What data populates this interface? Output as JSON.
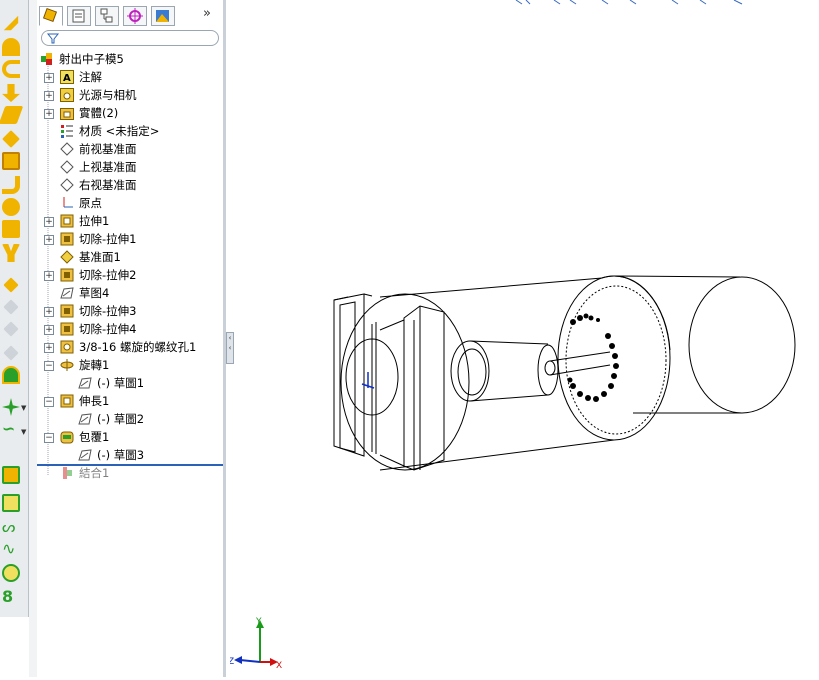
{
  "tree": {
    "root": "射出中子模5",
    "items": [
      {
        "label": "注解",
        "icon": "annotations-icon",
        "expand": "+"
      },
      {
        "label": "光源与相机",
        "icon": "lights-cameras-icon",
        "expand": "+"
      },
      {
        "label": "實體(2)",
        "icon": "solid-bodies-folder-icon",
        "expand": "+"
      },
      {
        "label": "材质 <未指定>",
        "icon": "material-icon",
        "expand": ""
      },
      {
        "label": "前视基准面",
        "icon": "plane-icon",
        "expand": ""
      },
      {
        "label": "上视基准面",
        "icon": "plane-icon",
        "expand": ""
      },
      {
        "label": "右视基准面",
        "icon": "plane-icon",
        "expand": ""
      },
      {
        "label": "原点",
        "icon": "origin-icon",
        "expand": ""
      },
      {
        "label": "拉伸1",
        "icon": "extrude-icon",
        "expand": "+"
      },
      {
        "label": "切除-拉伸1",
        "icon": "cut-extrude-icon",
        "expand": "+"
      },
      {
        "label": "基准面1",
        "icon": "reference-plane-icon",
        "expand": ""
      },
      {
        "label": "切除-拉伸2",
        "icon": "cut-extrude-icon",
        "expand": "+"
      },
      {
        "label": "草图4",
        "icon": "sketch-icon",
        "expand": ""
      },
      {
        "label": "切除-拉伸3",
        "icon": "cut-extrude-icon",
        "expand": "+"
      },
      {
        "label": "切除-拉伸4",
        "icon": "cut-extrude-icon",
        "expand": "+"
      },
      {
        "label": "3/8-16 螺旋的螺纹孔1",
        "icon": "hole-wizard-icon",
        "expand": "+"
      },
      {
        "label": "旋轉1",
        "icon": "revolve-icon",
        "expand": "−"
      },
      {
        "label": "(-) 草圖1",
        "icon": "sketch-icon",
        "expand": ""
      },
      {
        "label": "伸長1",
        "icon": "extrude-icon",
        "expand": "−"
      },
      {
        "label": "(-) 草圖2",
        "icon": "sketch-icon",
        "expand": ""
      },
      {
        "label": "包覆1",
        "icon": "wrap-icon",
        "expand": "−"
      },
      {
        "label": "(-) 草圖3",
        "icon": "sketch-icon",
        "expand": ""
      },
      {
        "label": "結合1",
        "icon": "combine-icon",
        "expand": ""
      }
    ]
  },
  "panel": {
    "more_label": "»"
  },
  "triad": {
    "x_label": "X",
    "y_label": "Y",
    "z_label": "Z"
  },
  "colors": {
    "accent": "#2a62b8",
    "yellow_icon": "#f0b400",
    "triad_x": "#d01010",
    "triad_y": "#1a9a1a",
    "triad_z": "#1030c0"
  }
}
